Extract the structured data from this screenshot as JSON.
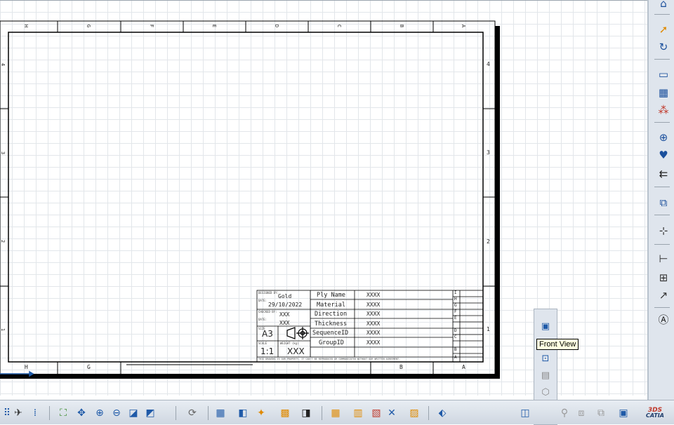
{
  "drawing": {
    "top_zones": [
      "H",
      "G",
      "F",
      "E",
      "D",
      "C",
      "B",
      "A"
    ],
    "bottom_zones": [
      "H",
      "G",
      "B",
      "A"
    ],
    "left_zones": [
      "4",
      "3",
      "2",
      "1"
    ],
    "right_zones": [
      "4",
      "3",
      "2",
      "1"
    ]
  },
  "title_block": {
    "designed_by_label": "DESIGNED BY:",
    "designed_by": "Gold",
    "date_label": "DATE:",
    "date": "29/10/2022",
    "checked_by_label": "CHECKED BY:",
    "checked_by": "XXX",
    "date2_label": "DATE:",
    "date2": "XXX",
    "size_label": "SIZE",
    "size": "A3",
    "scale_label": "SCALE",
    "scale": "1:1",
    "weight_label": "WEIGHT (kg)",
    "weight": "XXX",
    "footer": "THIS DRAWING IS OUR PROPERTY. IT CAN'T BE REPRODUCED OR COMMUNICATED WITHOUT OUR WRITTEN AGREEMENT.",
    "rows": [
      {
        "label": "Ply Name",
        "value": "XXXX"
      },
      {
        "label": "Material",
        "value": "XXXX"
      },
      {
        "label": "Direction",
        "value": "XXXX"
      },
      {
        "label": "Thickness",
        "value": "XXXX"
      },
      {
        "label": "SequenceID",
        "value": "XXXX"
      },
      {
        "label": "GroupID",
        "value": "XXXX"
      }
    ],
    "revision_letters": [
      "I",
      "H",
      "G",
      "F",
      "E",
      "D",
      "C",
      "B",
      "A"
    ]
  },
  "tooltip": {
    "text": "Front View"
  },
  "icons": {
    "right_toolbar": [
      "select-arrow-icon",
      "rotate-icon",
      "sheet-icon",
      "views-icon",
      "dress-up-icon",
      "point-icon",
      "annotation-icon",
      "arrow-icon",
      "sheets-icon",
      "axis-icon",
      "dimension-icon",
      "tolerance-icon",
      "chain-dimension-icon",
      "text-icon"
    ],
    "bottom_toolbar": [
      "grid-icon",
      "fit-all-icon",
      "pan-icon",
      "zoom-in-icon",
      "zoom-out-icon",
      "normal-view-icon",
      "update-icon",
      "catia-logo"
    ]
  },
  "brand": {
    "logo_text": "CATIA",
    "logo_mark": "3DS"
  },
  "colors": {
    "accent": "#1f5aa8",
    "tooltip_bg": "#ffffe1",
    "canvas_grid": "#e2e6ea"
  }
}
